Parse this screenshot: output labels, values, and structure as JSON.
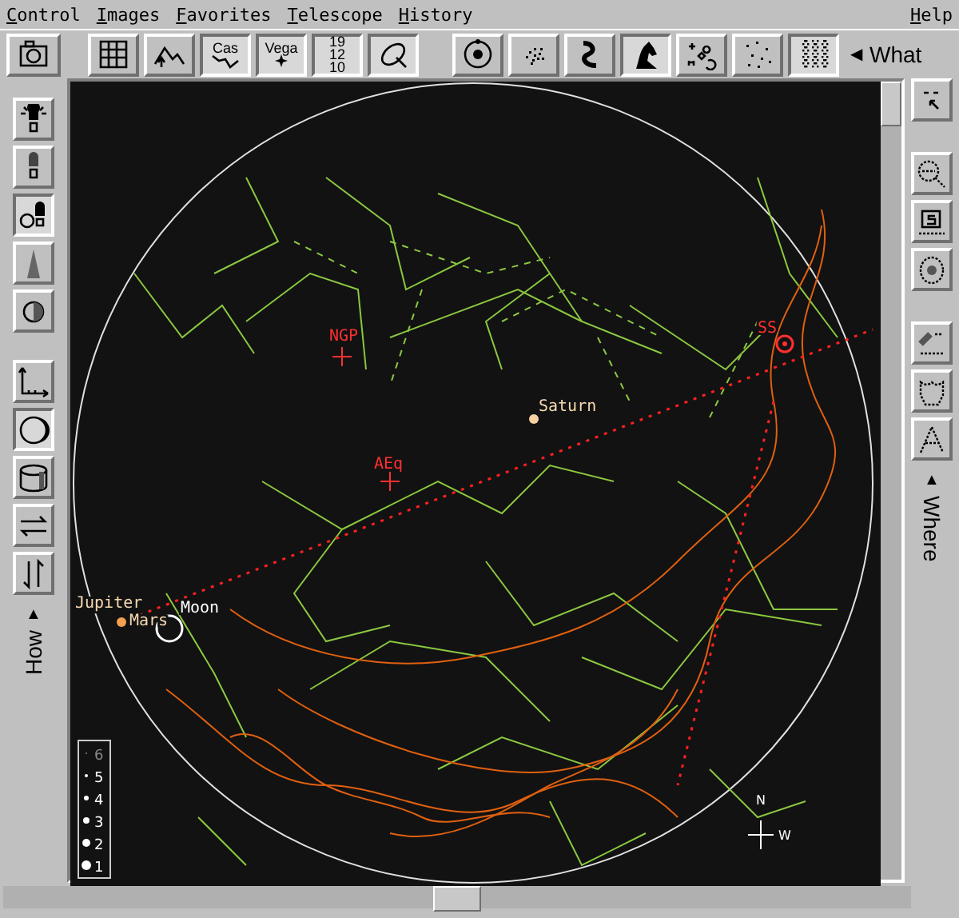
{
  "menu": [
    {
      "label": "Control"
    },
    {
      "label": "Images"
    },
    {
      "label": "Favorites"
    },
    {
      "label": "Telescope"
    },
    {
      "label": "History"
    }
  ],
  "help_menu": {
    "label": "Help"
  },
  "top_toolbar": [
    {
      "pressed": false
    },
    {
      "pressed": false
    },
    {
      "pressed": false
    },
    {
      "pressed": true,
      "label": "Cas"
    },
    {
      "pressed": true,
      "label": "Vega"
    },
    {
      "pressed": true,
      "labels": [
        "19",
        "12",
        "10"
      ]
    },
    {
      "pressed": true
    },
    {
      "pressed": false
    },
    {
      "pressed": false
    },
    {
      "pressed": false
    },
    {
      "pressed": true
    },
    {
      "pressed": false
    },
    {
      "pressed": false
    },
    {
      "pressed": true
    }
  ],
  "what_tab": "What",
  "what_arrow": "◀",
  "left_toolbar": [
    {
      "pressed": false
    },
    {
      "pressed": false
    },
    {
      "pressed": true
    },
    {
      "pressed": false
    },
    {
      "pressed": false
    },
    {
      "pressed": false
    },
    {
      "pressed": true
    },
    {
      "pressed": false
    },
    {
      "pressed": false
    },
    {
      "pressed": false
    }
  ],
  "how_tab": "How",
  "how_arrow": "▲",
  "right_toolbar": [
    {
      "pressed": false
    },
    {
      "pressed": false
    },
    {
      "pressed": false
    },
    {
      "pressed": false
    },
    {
      "pressed": false
    },
    {
      "pressed": false
    },
    {
      "pressed": false
    }
  ],
  "where_tab": "Where",
  "where_arrow": "▲",
  "chart": {
    "labels": [
      {
        "kind": "pole",
        "text": "NGP"
      },
      {
        "kind": "pole",
        "text": "AEq"
      },
      {
        "kind": "pole",
        "text": "SS"
      },
      {
        "kind": "planet",
        "text": "Saturn"
      },
      {
        "kind": "planet",
        "text": "Jupiter"
      },
      {
        "kind": "planet",
        "text": "Mars"
      },
      {
        "kind": "moon",
        "text": "Moon"
      }
    ],
    "legend": [
      "6",
      "5",
      "4",
      "3",
      "2",
      "1"
    ],
    "compass": {
      "north": "N",
      "west": "W"
    }
  }
}
